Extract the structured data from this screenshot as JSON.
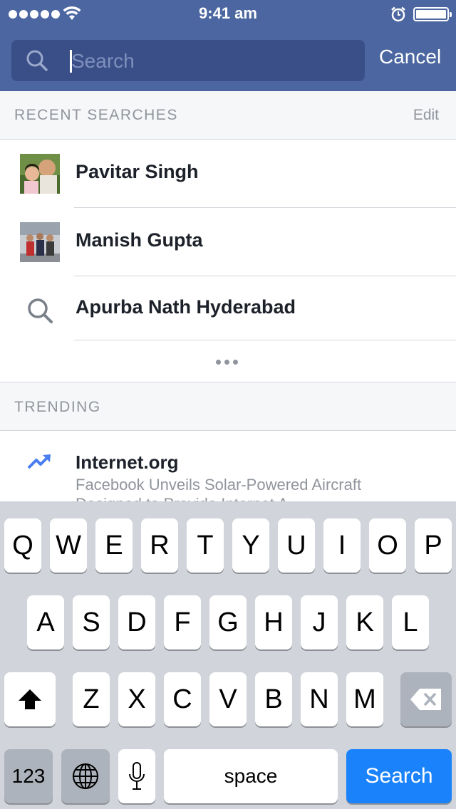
{
  "status": {
    "time": "9:41 am"
  },
  "search": {
    "placeholder": "Search",
    "cancel_label": "Cancel"
  },
  "recent": {
    "header": "RECENT SEARCHES",
    "edit_label": "Edit",
    "items": [
      {
        "label": "Pavitar Singh",
        "kind": "person"
      },
      {
        "label": "Manish Gupta",
        "kind": "person"
      },
      {
        "label": "Apurba Nath Hyderabad",
        "kind": "query"
      }
    ]
  },
  "trending": {
    "header": "TRENDING",
    "items": [
      {
        "title": "Internet.org",
        "subtitle": "Facebook Unveils Solar-Powered Aircraft",
        "subtitle2": "Designed to Provide Internet A..."
      }
    ]
  },
  "keyboard": {
    "row1": [
      "Q",
      "W",
      "E",
      "R",
      "T",
      "Y",
      "U",
      "I",
      "O",
      "P"
    ],
    "row2": [
      "A",
      "S",
      "D",
      "F",
      "G",
      "H",
      "J",
      "K",
      "L"
    ],
    "row3": [
      "Z",
      "X",
      "C",
      "V",
      "B",
      "N",
      "M"
    ],
    "numbers_label": "123",
    "space_label": "space",
    "action_label": "Search"
  },
  "colors": {
    "header_blue": "#4b66a0",
    "search_field": "#3a4f87",
    "action_blue": "#1a82fb"
  }
}
